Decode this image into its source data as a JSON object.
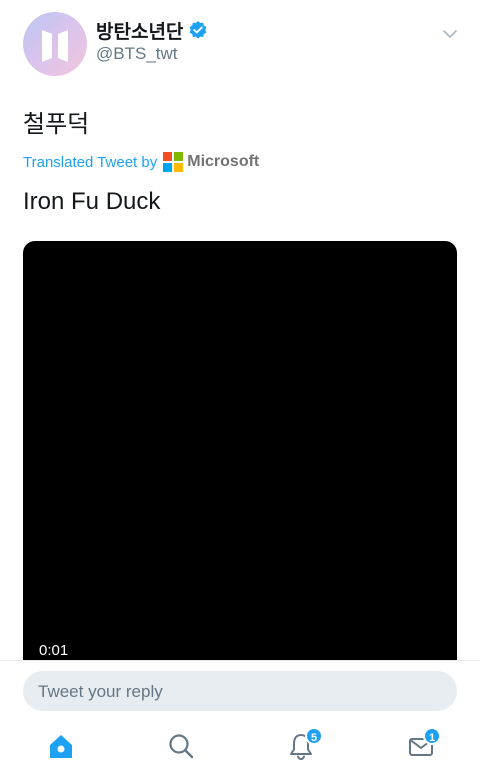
{
  "tweet": {
    "display_name": "방탄소년단",
    "handle": "@BTS_twt",
    "text": "철푸덕",
    "translated_label": "Translated Tweet by",
    "translator": "Microsoft",
    "translation": "Iron Fu Duck"
  },
  "video": {
    "elapsed": "0:01"
  },
  "reply": {
    "placeholder": "Tweet your reply"
  },
  "tabbar": {
    "notifications_badge": "5",
    "messages_badge": "1"
  },
  "colors": {
    "accent": "#1da1f2",
    "text_primary": "#14171a",
    "text_secondary": "#657786",
    "reply_bg": "#e6ecf0",
    "ms_red": "#f25022",
    "ms_green": "#7fba00",
    "ms_blue": "#00a4ef",
    "ms_yellow": "#ffb900"
  },
  "icons": {
    "avatar": "bts-logo",
    "verified": "verified-badge-icon",
    "menu": "chevron-down-icon",
    "home": "home-icon",
    "search": "search-icon",
    "notifications": "bell-icon",
    "messages": "mail-icon"
  }
}
